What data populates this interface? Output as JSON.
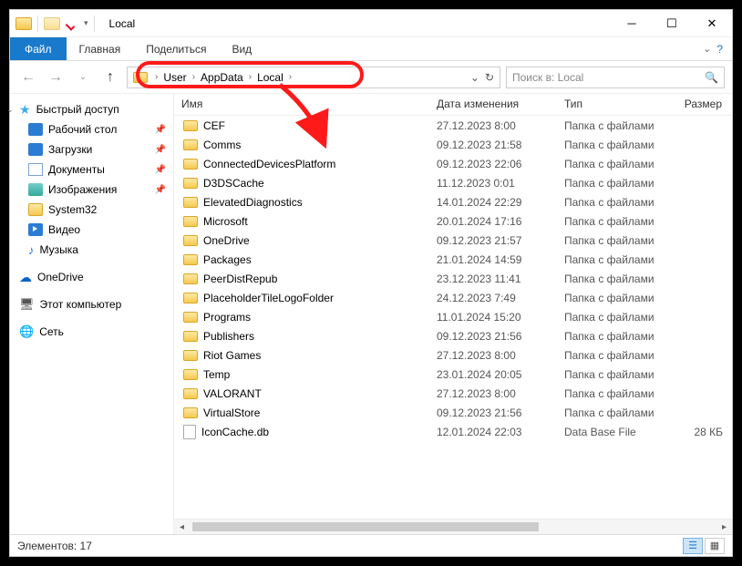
{
  "title": "Local",
  "ribbon": {
    "file": "Файл",
    "tabs": [
      "Главная",
      "Поделиться",
      "Вид"
    ]
  },
  "breadcrumb": [
    "User",
    "AppData",
    "Local"
  ],
  "search_placeholder": "Поиск в: Local",
  "columns": {
    "name": "Имя",
    "date": "Дата изменения",
    "type": "Тип",
    "size": "Размер"
  },
  "sidebar": {
    "quick": "Быстрый доступ",
    "items": [
      {
        "label": "Рабочий стол",
        "icon": "s-blue",
        "pin": true
      },
      {
        "label": "Загрузки",
        "icon": "s-blue",
        "pin": true
      },
      {
        "label": "Документы",
        "icon": "s-doc",
        "pin": true
      },
      {
        "label": "Изображения",
        "icon": "s-img",
        "pin": true
      },
      {
        "label": "System32",
        "icon": "s-folder",
        "pin": false
      },
      {
        "label": "Видео",
        "icon": "s-vid",
        "pin": false
      },
      {
        "label": "Музыка",
        "icon": "s-music",
        "pin": false
      }
    ],
    "onedrive": "OneDrive",
    "thispc": "Этот компьютер",
    "network": "Сеть"
  },
  "files": [
    {
      "name": "CEF",
      "date": "27.12.2023 8:00",
      "type": "Папка с файлами",
      "size": "",
      "icon": "folder"
    },
    {
      "name": "Comms",
      "date": "09.12.2023 21:58",
      "type": "Папка с файлами",
      "size": "",
      "icon": "folder"
    },
    {
      "name": "ConnectedDevicesPlatform",
      "date": "09.12.2023 22:06",
      "type": "Папка с файлами",
      "size": "",
      "icon": "folder"
    },
    {
      "name": "D3DSCache",
      "date": "11.12.2023 0:01",
      "type": "Папка с файлами",
      "size": "",
      "icon": "folder"
    },
    {
      "name": "ElevatedDiagnostics",
      "date": "14.01.2024 22:29",
      "type": "Папка с файлами",
      "size": "",
      "icon": "folder"
    },
    {
      "name": "Microsoft",
      "date": "20.01.2024 17:16",
      "type": "Папка с файлами",
      "size": "",
      "icon": "folder"
    },
    {
      "name": "OneDrive",
      "date": "09.12.2023 21:57",
      "type": "Папка с файлами",
      "size": "",
      "icon": "folder"
    },
    {
      "name": "Packages",
      "date": "21.01.2024 14:59",
      "type": "Папка с файлами",
      "size": "",
      "icon": "folder"
    },
    {
      "name": "PeerDistRepub",
      "date": "23.12.2023 11:41",
      "type": "Папка с файлами",
      "size": "",
      "icon": "folder"
    },
    {
      "name": "PlaceholderTileLogoFolder",
      "date": "24.12.2023 7:49",
      "type": "Папка с файлами",
      "size": "",
      "icon": "folder"
    },
    {
      "name": "Programs",
      "date": "11.01.2024 15:20",
      "type": "Папка с файлами",
      "size": "",
      "icon": "folder"
    },
    {
      "name": "Publishers",
      "date": "09.12.2023 21:56",
      "type": "Папка с файлами",
      "size": "",
      "icon": "folder"
    },
    {
      "name": "Riot Games",
      "date": "27.12.2023 8:00",
      "type": "Папка с файлами",
      "size": "",
      "icon": "folder"
    },
    {
      "name": "Temp",
      "date": "23.01.2024 20:05",
      "type": "Папка с файлами",
      "size": "",
      "icon": "folder"
    },
    {
      "name": "VALORANT",
      "date": "27.12.2023 8:00",
      "type": "Папка с файлами",
      "size": "",
      "icon": "folder"
    },
    {
      "name": "VirtualStore",
      "date": "09.12.2023 21:56",
      "type": "Папка с файлами",
      "size": "",
      "icon": "folder"
    },
    {
      "name": "IconCache.db",
      "date": "12.01.2024 22:03",
      "type": "Data Base File",
      "size": "28 КБ",
      "icon": "file"
    }
  ],
  "status": {
    "count_label": "Элементов: 17"
  }
}
